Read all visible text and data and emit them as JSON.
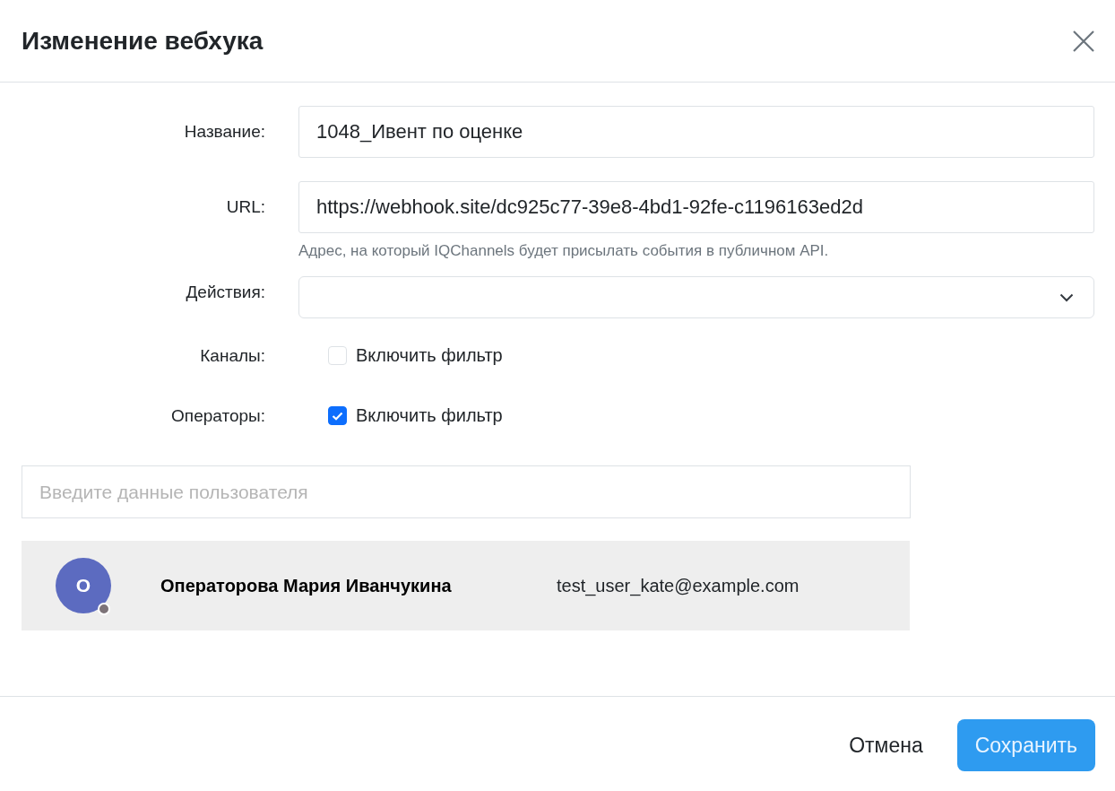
{
  "dialog": {
    "title": "Изменение вебхука"
  },
  "fields": [
    {
      "kind": "text",
      "label": "Название:",
      "value": "1048_Ивент по оценке"
    },
    {
      "kind": "text",
      "label": "URL:",
      "value": "https://webhook.site/dc925c77-39e8-4bd1-92fe-c1196163ed2d",
      "hint": "Адрес, на который IQChannels будет присылать события в публичном API."
    },
    {
      "kind": "select",
      "label": "Действия:"
    },
    {
      "kind": "checkbox",
      "label": "Каналы:",
      "option": "Включить фильтр",
      "checked": false
    },
    {
      "kind": "checkbox",
      "label": "Операторы:",
      "option": "Включить фильтр",
      "checked": true
    }
  ],
  "user_search": {
    "placeholder": "Введите данные пользователя"
  },
  "users": [
    {
      "initial": "О",
      "name": "Операторова Мария Иванчукина",
      "email": "test_user_kate@example.com"
    }
  ],
  "buttons": [
    {
      "kind": "secondary",
      "label": "Отмена"
    },
    {
      "kind": "primary",
      "label": "Сохранить"
    }
  ]
}
